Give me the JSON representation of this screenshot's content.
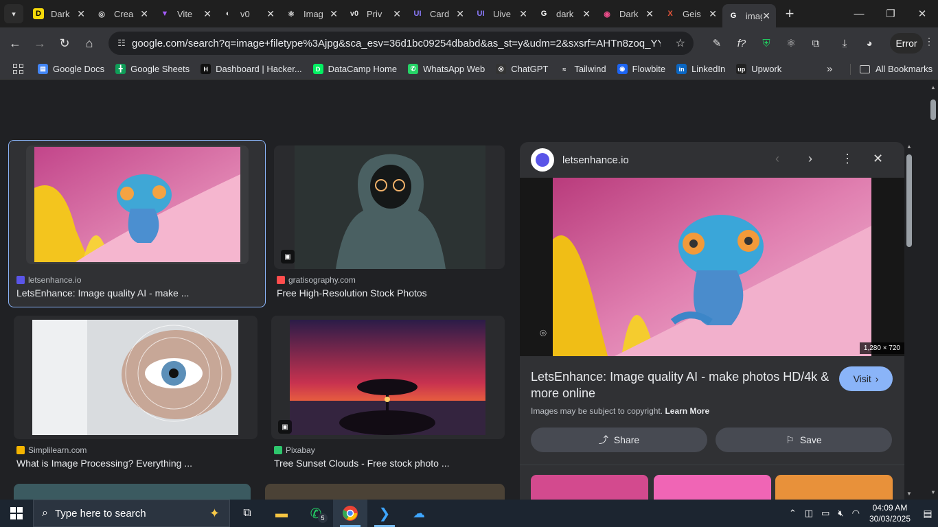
{
  "tabs": [
    {
      "title": "Dark",
      "fav": "D",
      "fav_color": "#f5d90a",
      "fav_text": "#000"
    },
    {
      "title": "Crea",
      "fav": "◎",
      "fav_color": "transparent",
      "fav_text": "#ddd"
    },
    {
      "title": "Vite",
      "fav": "▼",
      "fav_color": "transparent",
      "fav_text": "#a45bfd"
    },
    {
      "title": "v0",
      "fav": "◐",
      "fav_color": "transparent",
      "fav_text": "#ddd"
    },
    {
      "title": "Imag",
      "fav": "⚛",
      "fav_color": "transparent",
      "fav_text": "#ddd"
    },
    {
      "title": "Priv",
      "fav": "v0",
      "fav_color": "transparent",
      "fav_text": "#ddd"
    },
    {
      "title": "Card",
      "fav": "UI",
      "fav_color": "transparent",
      "fav_text": "#8d7cff"
    },
    {
      "title": "Uive",
      "fav": "UI",
      "fav_color": "transparent",
      "fav_text": "#8d7cff"
    },
    {
      "title": "dark",
      "fav": "G",
      "fav_color": "transparent",
      "fav_text": "#fff"
    },
    {
      "title": "Dark",
      "fav": "◉",
      "fav_color": "transparent",
      "fav_text": "#ea4c89"
    },
    {
      "title": "Geis",
      "fav": "X",
      "fav_color": "transparent",
      "fav_text": "#e8553a"
    },
    {
      "title": "imag",
      "fav": "G",
      "fav_color": "transparent",
      "fav_text": "#fff",
      "active": true
    }
  ],
  "address": {
    "url": "google.com/search?q=image+filetype%3Ajpg&sca_esv=36d1bc09254dbabd&as_st=y&udm=2&sxsrf=AHTn8zoq_YY32T23..."
  },
  "toolbar": {
    "error_label": "Error"
  },
  "bookmarks": [
    {
      "label": "Google Docs",
      "color": "#4285f4",
      "icon": "▤"
    },
    {
      "label": "Google Sheets",
      "color": "#0f9d58",
      "icon": "╋"
    },
    {
      "label": "Dashboard | Hacker...",
      "color": "#111",
      "icon": "H"
    },
    {
      "label": "DataCamp Home",
      "color": "#03ef62",
      "icon": "D"
    },
    {
      "label": "WhatsApp Web",
      "color": "#25d366",
      "icon": "✆"
    },
    {
      "label": "ChatGPT",
      "color": "#333",
      "icon": "◎"
    },
    {
      "label": "Tailwind",
      "color": "transparent",
      "icon": "≈"
    },
    {
      "label": "Flowbite",
      "color": "#1c64f2",
      "icon": "◉"
    },
    {
      "label": "LinkedIn",
      "color": "#0a66c2",
      "icon": "in"
    },
    {
      "label": "Upwork",
      "color": "#222",
      "icon": "up"
    }
  ],
  "bookmarks_all": "All Bookmarks",
  "results": [
    {
      "source": "letsenhance.io",
      "title": "LetsEnhance: Image quality AI - make ...",
      "fav_color": "#5a55e8"
    },
    {
      "source": "gratisography.com",
      "title": "Free High-Resolution Stock Photos",
      "fav_color": "#ff4d4d"
    },
    {
      "source": "Simplilearn.com",
      "title": "What is Image Processing? Everything ...",
      "fav_color": "#f4b400"
    },
    {
      "source": "Pixabay",
      "title": "Tree Sunset Clouds - Free stock photo ...",
      "fav_color": "#2ec66d"
    }
  ],
  "preview": {
    "domain": "letsenhance.io",
    "dims": "1,280 × 720",
    "title": "LetsEnhance: Image quality AI - make photos HD/4k & more online",
    "visit": "Visit",
    "copyright": "Images may be subject to copyright.",
    "learn_more": "Learn More",
    "share": "Share",
    "save": "Save"
  },
  "taskbar": {
    "search_placeholder": "Type here to search",
    "whatsapp_badge": "5",
    "time": "04:09 AM",
    "date": "30/03/2025"
  }
}
